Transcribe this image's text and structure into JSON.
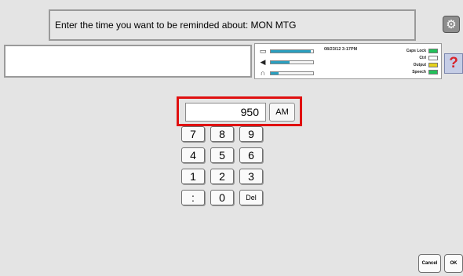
{
  "prompt": "Enter the time you want to be reminded about: MON MTG",
  "status": {
    "datetime": "08/23/12 3:17PM",
    "meters": [
      {
        "icon": "calendar-icon",
        "glyph": "▭",
        "level": 0.95
      },
      {
        "icon": "speaker-icon",
        "glyph": "◀",
        "level": 0.45
      },
      {
        "icon": "headphones-icon",
        "glyph": "∩",
        "level": 0.18
      }
    ],
    "indicators": [
      {
        "label": "Caps Lock",
        "state": "on",
        "color": "#22c15a"
      },
      {
        "label": "Ctrl",
        "state": "off",
        "color": "#ffffff"
      },
      {
        "label": "Output",
        "state": "on",
        "color": "#e6d21c"
      },
      {
        "label": "Speech",
        "state": "on",
        "color": "#22c15a"
      }
    ]
  },
  "time_entry": {
    "value": "950",
    "ampm": "AM"
  },
  "keypad": {
    "keys": [
      "7",
      "8",
      "9",
      "4",
      "5",
      "6",
      "1",
      "2",
      "3",
      ":",
      "0",
      "Del"
    ]
  },
  "buttons": {
    "help": "?",
    "cancel": "Cancel",
    "ok": "OK"
  },
  "colors": {
    "highlight": "#e01010",
    "meter_fill": "#2a9fbf"
  }
}
